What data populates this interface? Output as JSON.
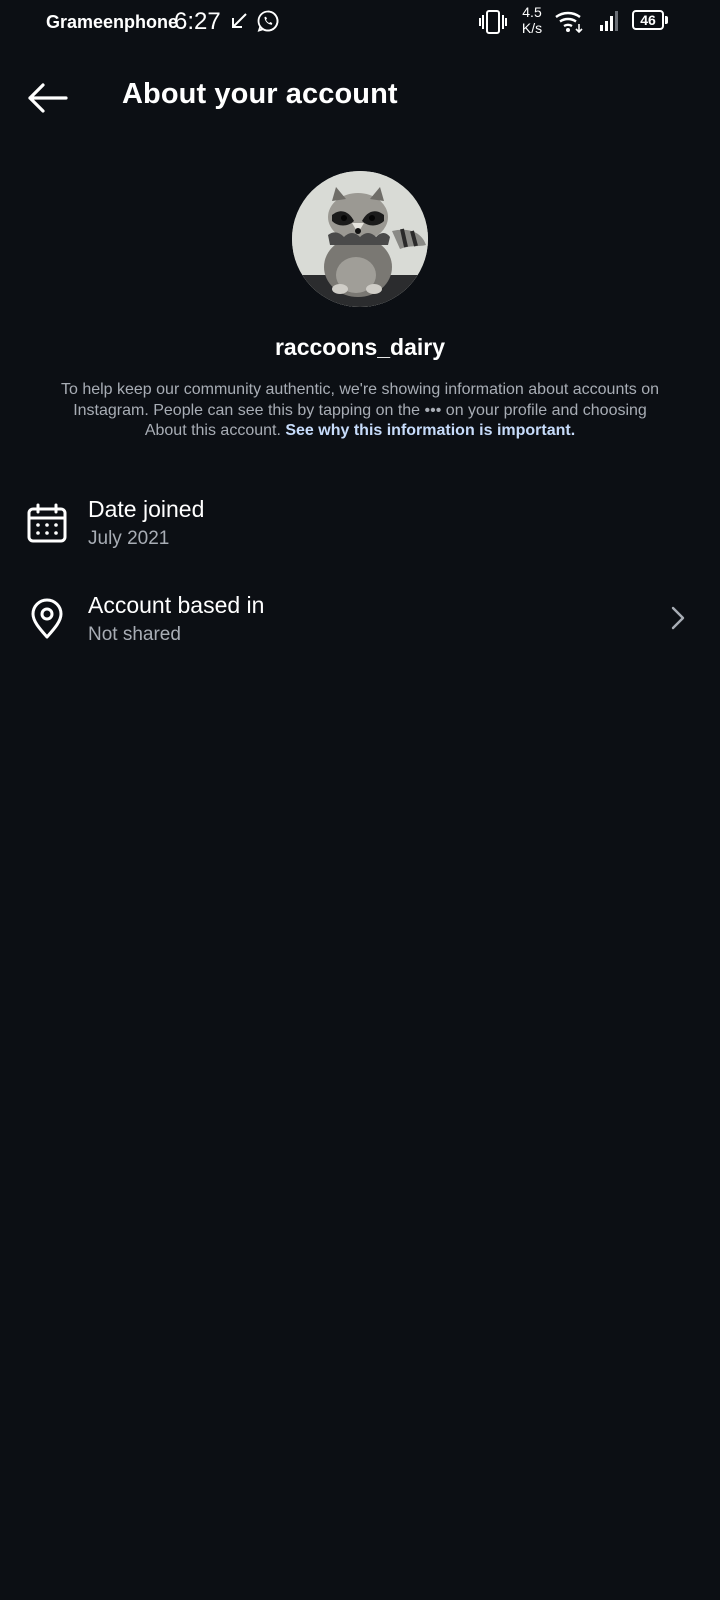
{
  "status_bar": {
    "carrier": "Grameenphone",
    "time": "6:27",
    "speed_value": "4.5",
    "speed_unit": "K/s",
    "battery": "46"
  },
  "header": {
    "title": "About your account"
  },
  "profile": {
    "username": "raccoons_dairy"
  },
  "info": {
    "text_1": "To help keep our community authentic, we're showing information about accounts on Instagram. People can see this by tapping on the ",
    "dots": "•••",
    "text_2": " on your profile and choosing About this account. ",
    "link": "See why this information is important."
  },
  "rows": [
    {
      "icon": "calendar-icon",
      "title": "Date joined",
      "subtitle": "July 2021"
    },
    {
      "icon": "location-pin-icon",
      "title": "Account based in",
      "subtitle": "Not shared"
    }
  ],
  "colors": {
    "background": "#0c0f14",
    "primary_text": "#ffffff",
    "secondary_text": "#a8adb5",
    "link": "#c7dcfb"
  }
}
